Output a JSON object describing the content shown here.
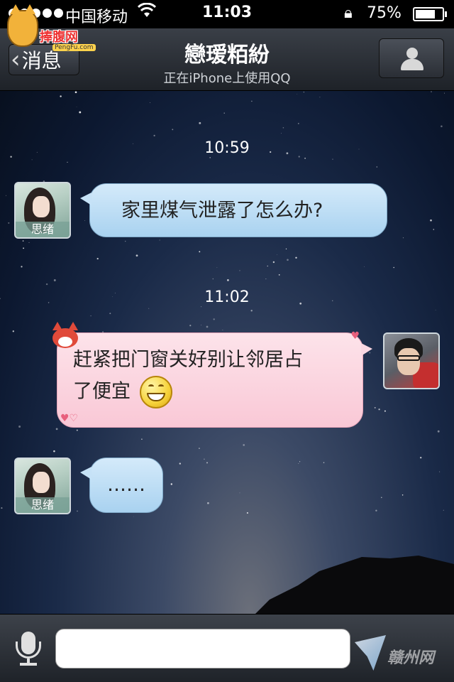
{
  "status_bar": {
    "carrier": "中国移动",
    "time": "11:03",
    "battery": "75%",
    "battery_level": 0.75
  },
  "watermark": {
    "logo_text": "捧腹网",
    "logo_url": "PengFu.com",
    "corner_text": "赣州网"
  },
  "nav": {
    "back_label": "消息",
    "title": "戀瑷粨紛",
    "subtitle": "正在iPhone上使用QQ"
  },
  "messages": [
    {
      "type": "timestamp",
      "text": "10:59"
    },
    {
      "type": "incoming",
      "sender": "思绪",
      "text": "家里煤气泄露了怎么办?"
    },
    {
      "type": "timestamp",
      "text": "11:02"
    },
    {
      "type": "outgoing",
      "lines": [
        "赶紧把门窗关好别让邻居占",
        "了便宜"
      ],
      "emoji": "grin-emoji"
    },
    {
      "type": "incoming",
      "sender": "思绪",
      "text": "……"
    }
  ],
  "input": {
    "placeholder": ""
  },
  "colors": {
    "incoming_bubble": "#bfe0f6",
    "outgoing_bubble": "#fbd0dc",
    "nav_bar": "#2a2e35"
  },
  "icons": {
    "back": "chevron-left-icon",
    "profile": "person-icon",
    "voice": "microphone-icon",
    "wifi": "wifi-icon",
    "lock": "rotation-lock-icon"
  }
}
